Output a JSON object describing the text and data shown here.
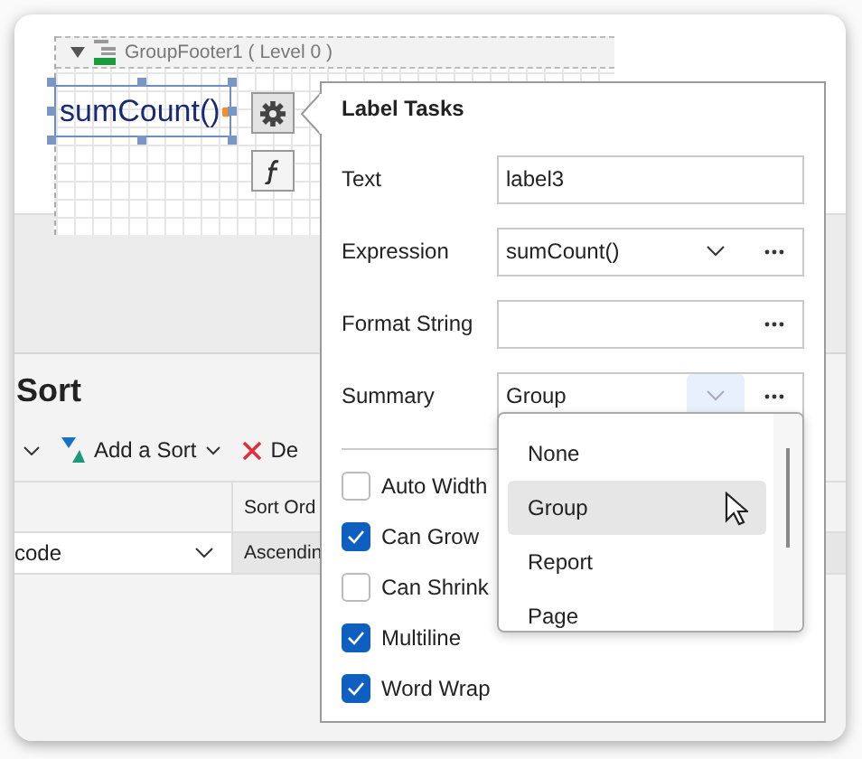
{
  "designer": {
    "band_title": "GroupFooter1 ( Level 0 )",
    "label_text": "sumCount()",
    "smart_tag_selected": true
  },
  "sort_panel": {
    "title": "Sort",
    "toolbar": [
      {
        "kind": "menu"
      },
      {
        "kind": "add",
        "label": "Add a Sort"
      },
      {
        "kind": "delete",
        "label": "De"
      }
    ],
    "column_2_header": "Sort Ord",
    "rows": [
      {
        "cells": [
          "code",
          "Ascendin"
        ]
      }
    ]
  },
  "label_tasks": {
    "title": "Label Tasks",
    "fields": [
      {
        "kind": "text",
        "label": "Text",
        "value": "label3"
      },
      {
        "kind": "combo",
        "label": "Expression",
        "value": "sumCount()",
        "open": false
      },
      {
        "kind": "ellipsis",
        "label": "Format String"
      },
      {
        "kind": "combo",
        "label": "Summary",
        "value": "Group",
        "open": true
      }
    ],
    "checkboxes": [
      {
        "label": "Auto Width",
        "checked": false
      },
      {
        "label": "Can Grow",
        "checked": true
      },
      {
        "label": "Can Shrink",
        "checked": false
      },
      {
        "label": "Multiline",
        "checked": true
      },
      {
        "label": "Word Wrap",
        "checked": true
      }
    ],
    "dropdown": [
      {
        "label": "None",
        "selected": false
      },
      {
        "label": "Group",
        "selected": true
      },
      {
        "label": "Report",
        "selected": false
      },
      {
        "label": "Page",
        "selected": false
      }
    ]
  }
}
